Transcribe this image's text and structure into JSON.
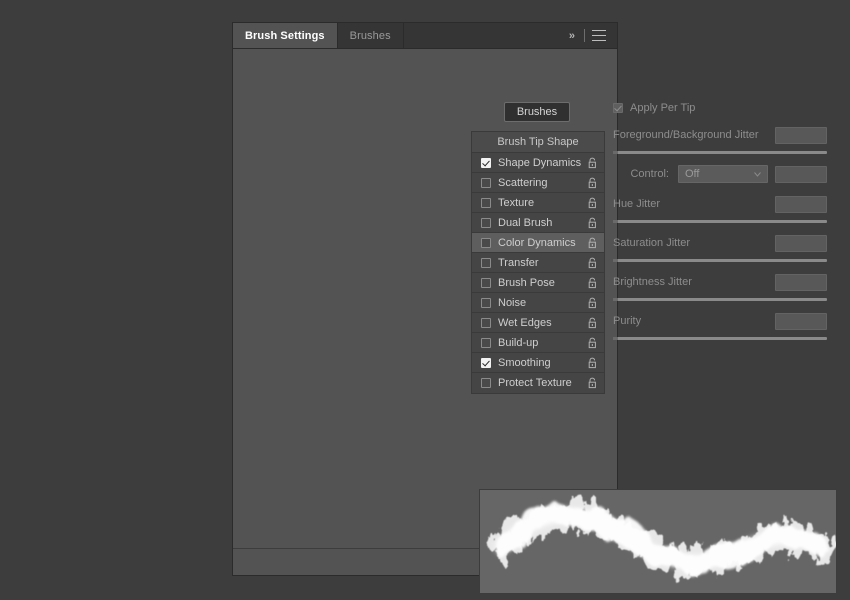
{
  "panel": {
    "tabs": [
      {
        "label": "Brush Settings",
        "active": true
      },
      {
        "label": "Brushes",
        "active": false
      }
    ],
    "collapse_icon": "»",
    "menu_icon": "hamburger-menu-icon",
    "brushes_button": "Brushes"
  },
  "list": {
    "header": "Brush Tip Shape",
    "items": [
      {
        "label": "Shape Dynamics",
        "checked": true,
        "selected": false
      },
      {
        "label": "Scattering",
        "checked": false,
        "selected": false
      },
      {
        "label": "Texture",
        "checked": false,
        "selected": false
      },
      {
        "label": "Dual Brush",
        "checked": false,
        "selected": false
      },
      {
        "label": "Color Dynamics",
        "checked": false,
        "selected": true
      },
      {
        "label": "Transfer",
        "checked": false,
        "selected": false
      },
      {
        "label": "Brush Pose",
        "checked": false,
        "selected": false
      },
      {
        "label": "Noise",
        "checked": false,
        "selected": false
      },
      {
        "label": "Wet Edges",
        "checked": false,
        "selected": false
      },
      {
        "label": "Build-up",
        "checked": false,
        "selected": false
      },
      {
        "label": "Smoothing",
        "checked": true,
        "selected": false
      },
      {
        "label": "Protect Texture",
        "checked": false,
        "selected": false
      }
    ]
  },
  "options": {
    "apply_per_tip": {
      "label": "Apply Per Tip",
      "checked": true,
      "disabled": true
    },
    "foreground_background_jitter": {
      "label": "Foreground/Background Jitter",
      "value": ""
    },
    "control": {
      "label": "Control:",
      "value": "Off",
      "extra_value": ""
    },
    "hue_jitter": {
      "label": "Hue Jitter",
      "value": ""
    },
    "saturation_jitter": {
      "label": "Saturation Jitter",
      "value": ""
    },
    "brightness_jitter": {
      "label": "Brightness Jitter",
      "value": ""
    },
    "purity": {
      "label": "Purity",
      "value": ""
    }
  },
  "preview": {
    "name": "brush-stroke-preview"
  },
  "footer": {
    "toggle_preview_icon": "eye-slash-icon",
    "new_brush_icon": "new-brush-icon"
  },
  "colors": {
    "app_background": "#3d3d3d",
    "panel_background": "#535353",
    "tabbar_background": "#353535",
    "list_background": "#454545",
    "selected_row": "#5e5e5e",
    "disabled_text": "#8d8d8d",
    "active_text": "#ffffff",
    "preview_background": "#666666"
  }
}
